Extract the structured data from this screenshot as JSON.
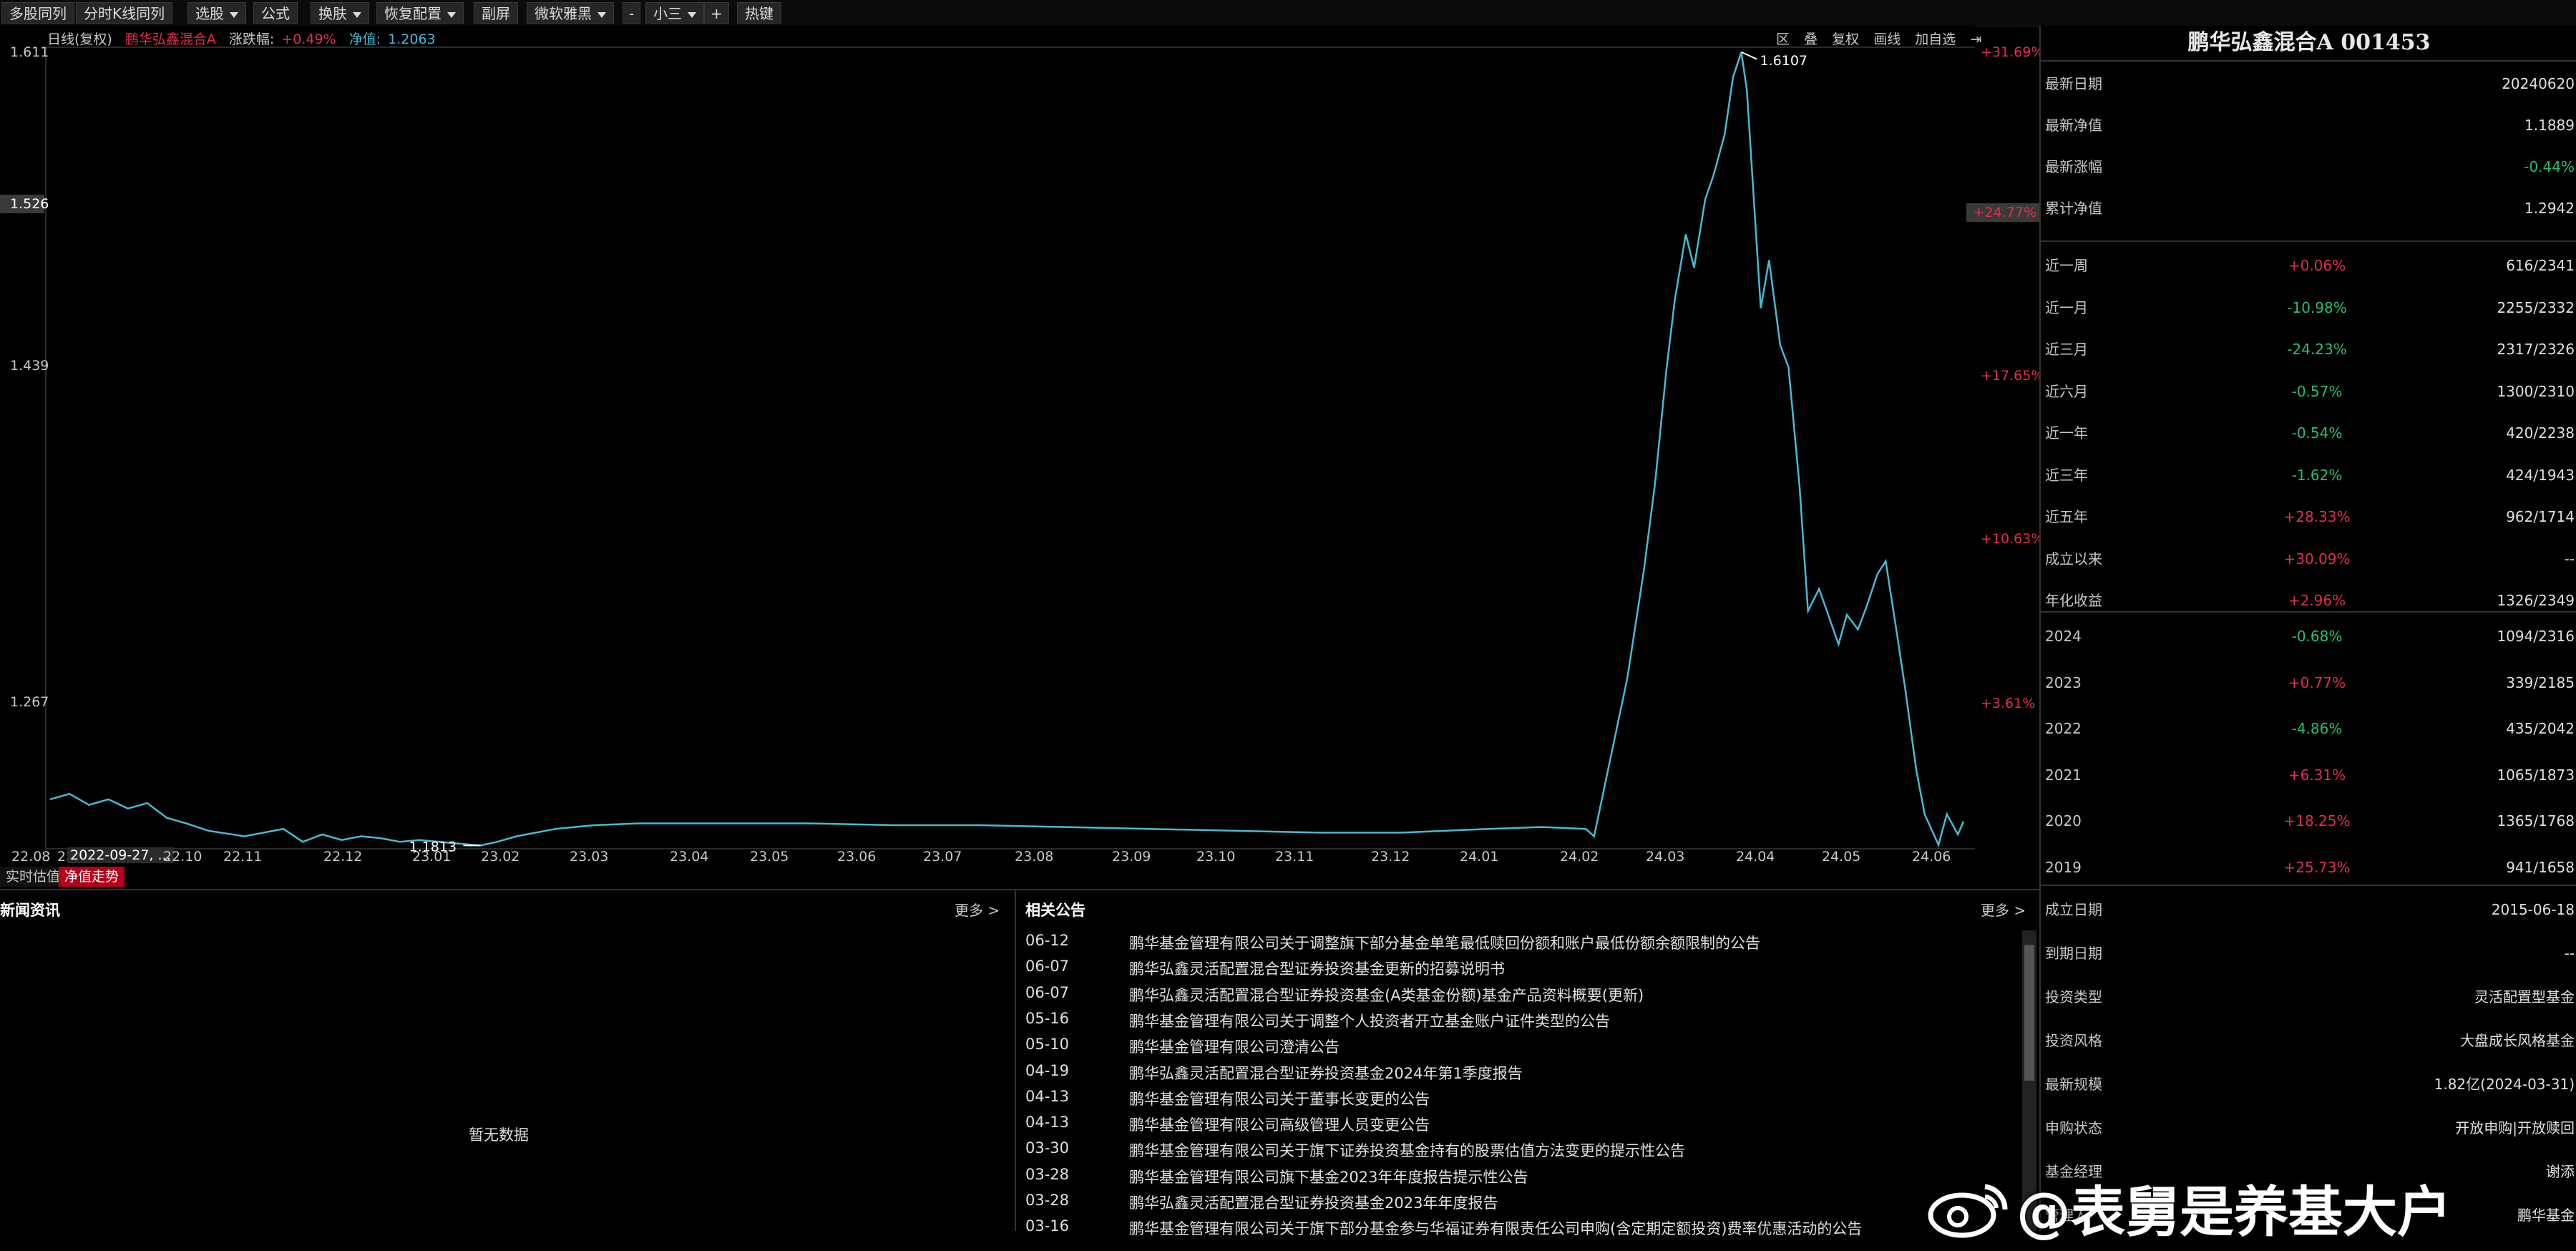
{
  "toolbar": {
    "buttons": [
      "多股同列",
      "分时K线同列",
      "选股",
      "公式",
      "换肤",
      "恢复配置",
      "副屏",
      "微软雅黑",
      "小三",
      "热键"
    ],
    "minus": "-",
    "plus": "+"
  },
  "chart_header": {
    "mode": "日线(复权)",
    "fund_name": "鹏华弘鑫混合A",
    "change_label": "涨跌幅:",
    "change_value": "+0.49%",
    "nav_label": "净值:",
    "nav_value": "1.2063"
  },
  "chart_tools": [
    "区",
    "叠",
    "复权",
    "画线",
    "加自选"
  ],
  "mode_tabs": [
    "实时估值",
    "净值走势"
  ],
  "chart_data": {
    "type": "line",
    "title": "",
    "xlabel": "",
    "ylabel": "",
    "ylim": [
      1.18,
      1.611
    ],
    "y_ticks": [
      "1.611",
      "1.526",
      "1.439",
      "1.267"
    ],
    "y_highlight": "1.526",
    "right_pct_ticks": [
      "+31.69%",
      "+24.77%",
      "+17.65%",
      "+10.63%",
      "+3.61%"
    ],
    "right_pct_highlight": "+24.77%",
    "x_ticks": [
      "22.08",
      "22",
      "22.10",
      "22.11",
      "22.12",
      "23.01",
      "23.02",
      "23.03",
      "23.04",
      "23.05",
      "23.06",
      "23.07",
      "23.08",
      "23.09",
      "23.10",
      "23.11",
      "23.12",
      "24.01",
      "24.02",
      "24.03",
      "24.04",
      "24.05",
      "24.06"
    ],
    "x_cursor_label": "2022-09-27, ...",
    "max_label": "1.6107",
    "min_label": "1.1813",
    "line_color": "#49b9d4",
    "x_range": [
      "2022-08-01",
      "2024-06-20"
    ],
    "series": [
      {
        "points": [
          [
            "2022-08-01",
            1.206
          ],
          [
            "2022-08-08",
            1.209
          ],
          [
            "2022-08-15",
            1.203
          ],
          [
            "2022-08-22",
            1.206
          ],
          [
            "2022-08-29",
            1.201
          ],
          [
            "2022-09-05",
            1.204
          ],
          [
            "2022-09-12",
            1.196
          ],
          [
            "2022-09-19",
            1.193
          ],
          [
            "2022-09-27",
            1.189
          ],
          [
            "2022-10-10",
            1.186
          ],
          [
            "2022-10-24",
            1.19
          ],
          [
            "2022-10-31",
            1.183
          ],
          [
            "2022-11-07",
            1.187
          ],
          [
            "2022-11-14",
            1.184
          ],
          [
            "2022-11-21",
            1.186
          ],
          [
            "2022-11-28",
            1.185
          ],
          [
            "2022-12-05",
            1.183
          ],
          [
            "2022-12-12",
            1.184
          ],
          [
            "2022-12-19",
            1.183
          ],
          [
            "2022-12-26",
            1.182
          ],
          [
            "2023-01-03",
            1.181
          ],
          [
            "2023-01-09",
            1.183
          ],
          [
            "2023-01-16",
            1.186
          ],
          [
            "2023-01-30",
            1.19
          ],
          [
            "2023-02-13",
            1.192
          ],
          [
            "2023-03-01",
            1.193
          ],
          [
            "2023-04-01",
            1.193
          ],
          [
            "2023-05-01",
            1.193
          ],
          [
            "2023-06-01",
            1.192
          ],
          [
            "2023-07-01",
            1.192
          ],
          [
            "2023-08-01",
            1.191
          ],
          [
            "2023-09-01",
            1.19
          ],
          [
            "2023-10-01",
            1.189
          ],
          [
            "2023-11-01",
            1.188
          ],
          [
            "2023-12-01",
            1.188
          ],
          [
            "2024-01-01",
            1.19
          ],
          [
            "2024-01-20",
            1.191
          ],
          [
            "2024-02-05",
            1.19
          ],
          [
            "2024-02-08",
            1.186
          ],
          [
            "2024-02-20",
            1.272
          ],
          [
            "2024-02-26",
            1.331
          ],
          [
            "2024-03-01",
            1.378
          ],
          [
            "2024-03-05",
            1.438
          ],
          [
            "2024-03-08",
            1.476
          ],
          [
            "2024-03-12",
            1.512
          ],
          [
            "2024-03-15",
            1.494
          ],
          [
            "2024-03-19",
            1.531
          ],
          [
            "2024-03-22",
            1.544
          ],
          [
            "2024-03-26",
            1.566
          ],
          [
            "2024-03-29",
            1.597
          ],
          [
            "2024-04-01",
            1.6107
          ],
          [
            "2024-04-03",
            1.59
          ],
          [
            "2024-04-08",
            1.472
          ],
          [
            "2024-04-11",
            1.498
          ],
          [
            "2024-04-15",
            1.452
          ],
          [
            "2024-04-18",
            1.44
          ],
          [
            "2024-04-22",
            1.375
          ],
          [
            "2024-04-25",
            1.308
          ],
          [
            "2024-04-29",
            1.32
          ],
          [
            "2024-05-06",
            1.29
          ],
          [
            "2024-05-09",
            1.306
          ],
          [
            "2024-05-13",
            1.298
          ],
          [
            "2024-05-16",
            1.31
          ],
          [
            "2024-05-20",
            1.328
          ],
          [
            "2024-05-23",
            1.335
          ],
          [
            "2024-05-27",
            1.296
          ],
          [
            "2024-05-30",
            1.266
          ],
          [
            "2024-06-03",
            1.222
          ],
          [
            "2024-06-06",
            1.198
          ],
          [
            "2024-06-11",
            1.1813
          ],
          [
            "2024-06-14",
            1.198
          ],
          [
            "2024-06-18",
            1.187
          ],
          [
            "2024-06-20",
            1.194
          ]
        ]
      }
    ]
  },
  "right_panel": {
    "title": "鹏华弘鑫混合A 001453",
    "basic": [
      {
        "label": "最新日期",
        "value": "20240620"
      },
      {
        "label": "最新净值",
        "value": "1.1889"
      },
      {
        "label": "最新涨幅",
        "value": "-0.44%"
      },
      {
        "label": "累计净值",
        "value": "1.2942"
      }
    ],
    "periods": [
      {
        "label": "近一周",
        "pct": "+0.06%",
        "rank": "616/2341"
      },
      {
        "label": "近一月",
        "pct": "-10.98%",
        "rank": "2255/2332"
      },
      {
        "label": "近三月",
        "pct": "-24.23%",
        "rank": "2317/2326"
      },
      {
        "label": "近六月",
        "pct": "-0.57%",
        "rank": "1300/2310"
      },
      {
        "label": "近一年",
        "pct": "-0.54%",
        "rank": "420/2238"
      },
      {
        "label": "近三年",
        "pct": "-1.62%",
        "rank": "424/1943"
      },
      {
        "label": "近五年",
        "pct": "+28.33%",
        "rank": "962/1714"
      },
      {
        "label": "成立以来",
        "pct": "+30.09%",
        "rank": "--"
      },
      {
        "label": "年化收益",
        "pct": "+2.96%",
        "rank": "1326/2349"
      }
    ],
    "years": [
      {
        "label": "2024",
        "pct": "-0.68%",
        "rank": "1094/2316"
      },
      {
        "label": "2023",
        "pct": "+0.77%",
        "rank": "339/2185"
      },
      {
        "label": "2022",
        "pct": "-4.86%",
        "rank": "435/2042"
      },
      {
        "label": "2021",
        "pct": "+6.31%",
        "rank": "1065/1873"
      },
      {
        "label": "2020",
        "pct": "+18.25%",
        "rank": "1365/1768"
      },
      {
        "label": "2019",
        "pct": "+25.73%",
        "rank": "941/1658"
      }
    ],
    "info": [
      {
        "label": "成立日期",
        "value": "2015-06-18"
      },
      {
        "label": "到期日期",
        "value": "--"
      },
      {
        "label": "投资类型",
        "value": "灵活配置型基金"
      },
      {
        "label": "投资风格",
        "value": "大盘成长风格基金"
      },
      {
        "label": "最新规模",
        "value": "1.82亿(2024-03-31)"
      },
      {
        "label": "申购状态",
        "value": "开放申购|开放赎回"
      },
      {
        "label": "基金经理",
        "value": "谢添"
      },
      {
        "label": "管理人",
        "value": "鹏华基金"
      }
    ],
    "colors": {
      "up": "#e0304a",
      "down": "#27c06a"
    }
  },
  "news": {
    "title": "新闻资讯",
    "more": "更多 >",
    "empty": "暂无数据"
  },
  "announcements": {
    "title": "相关公告",
    "more": "更多 >",
    "items": [
      {
        "date": "06-12",
        "text": "鹏华基金管理有限公司关于调整旗下部分基金单笔最低赎回份额和账户最低份额余额限制的公告"
      },
      {
        "date": "06-07",
        "text": "鹏华弘鑫灵活配置混合型证券投资基金更新的招募说明书"
      },
      {
        "date": "06-07",
        "text": "鹏华弘鑫灵活配置混合型证券投资基金(A类基金份额)基金产品资料概要(更新)"
      },
      {
        "date": "05-16",
        "text": "鹏华基金管理有限公司关于调整个人投资者开立基金账户证件类型的公告"
      },
      {
        "date": "05-10",
        "text": "鹏华基金管理有限公司澄清公告"
      },
      {
        "date": "04-19",
        "text": "鹏华弘鑫灵活配置混合型证券投资基金2024年第1季度报告"
      },
      {
        "date": "04-13",
        "text": "鹏华基金管理有限公司关于董事长变更的公告"
      },
      {
        "date": "04-13",
        "text": "鹏华基金管理有限公司高级管理人员变更公告"
      },
      {
        "date": "03-30",
        "text": "鹏华基金管理有限公司关于旗下证券投资基金持有的股票估值方法变更的提示性公告"
      },
      {
        "date": "03-28",
        "text": "鹏华基金管理有限公司旗下基金2023年年度报告提示性公告"
      },
      {
        "date": "03-28",
        "text": "鹏华弘鑫灵活配置混合型证券投资基金2023年年度报告"
      },
      {
        "date": "03-16",
        "text": "鹏华基金管理有限公司关于旗下部分基金参与华福证券有限责任公司申购(含定期定额投资)费率优惠活动的公告"
      }
    ]
  },
  "watermark": {
    "text": "@表舅是养基大户"
  }
}
